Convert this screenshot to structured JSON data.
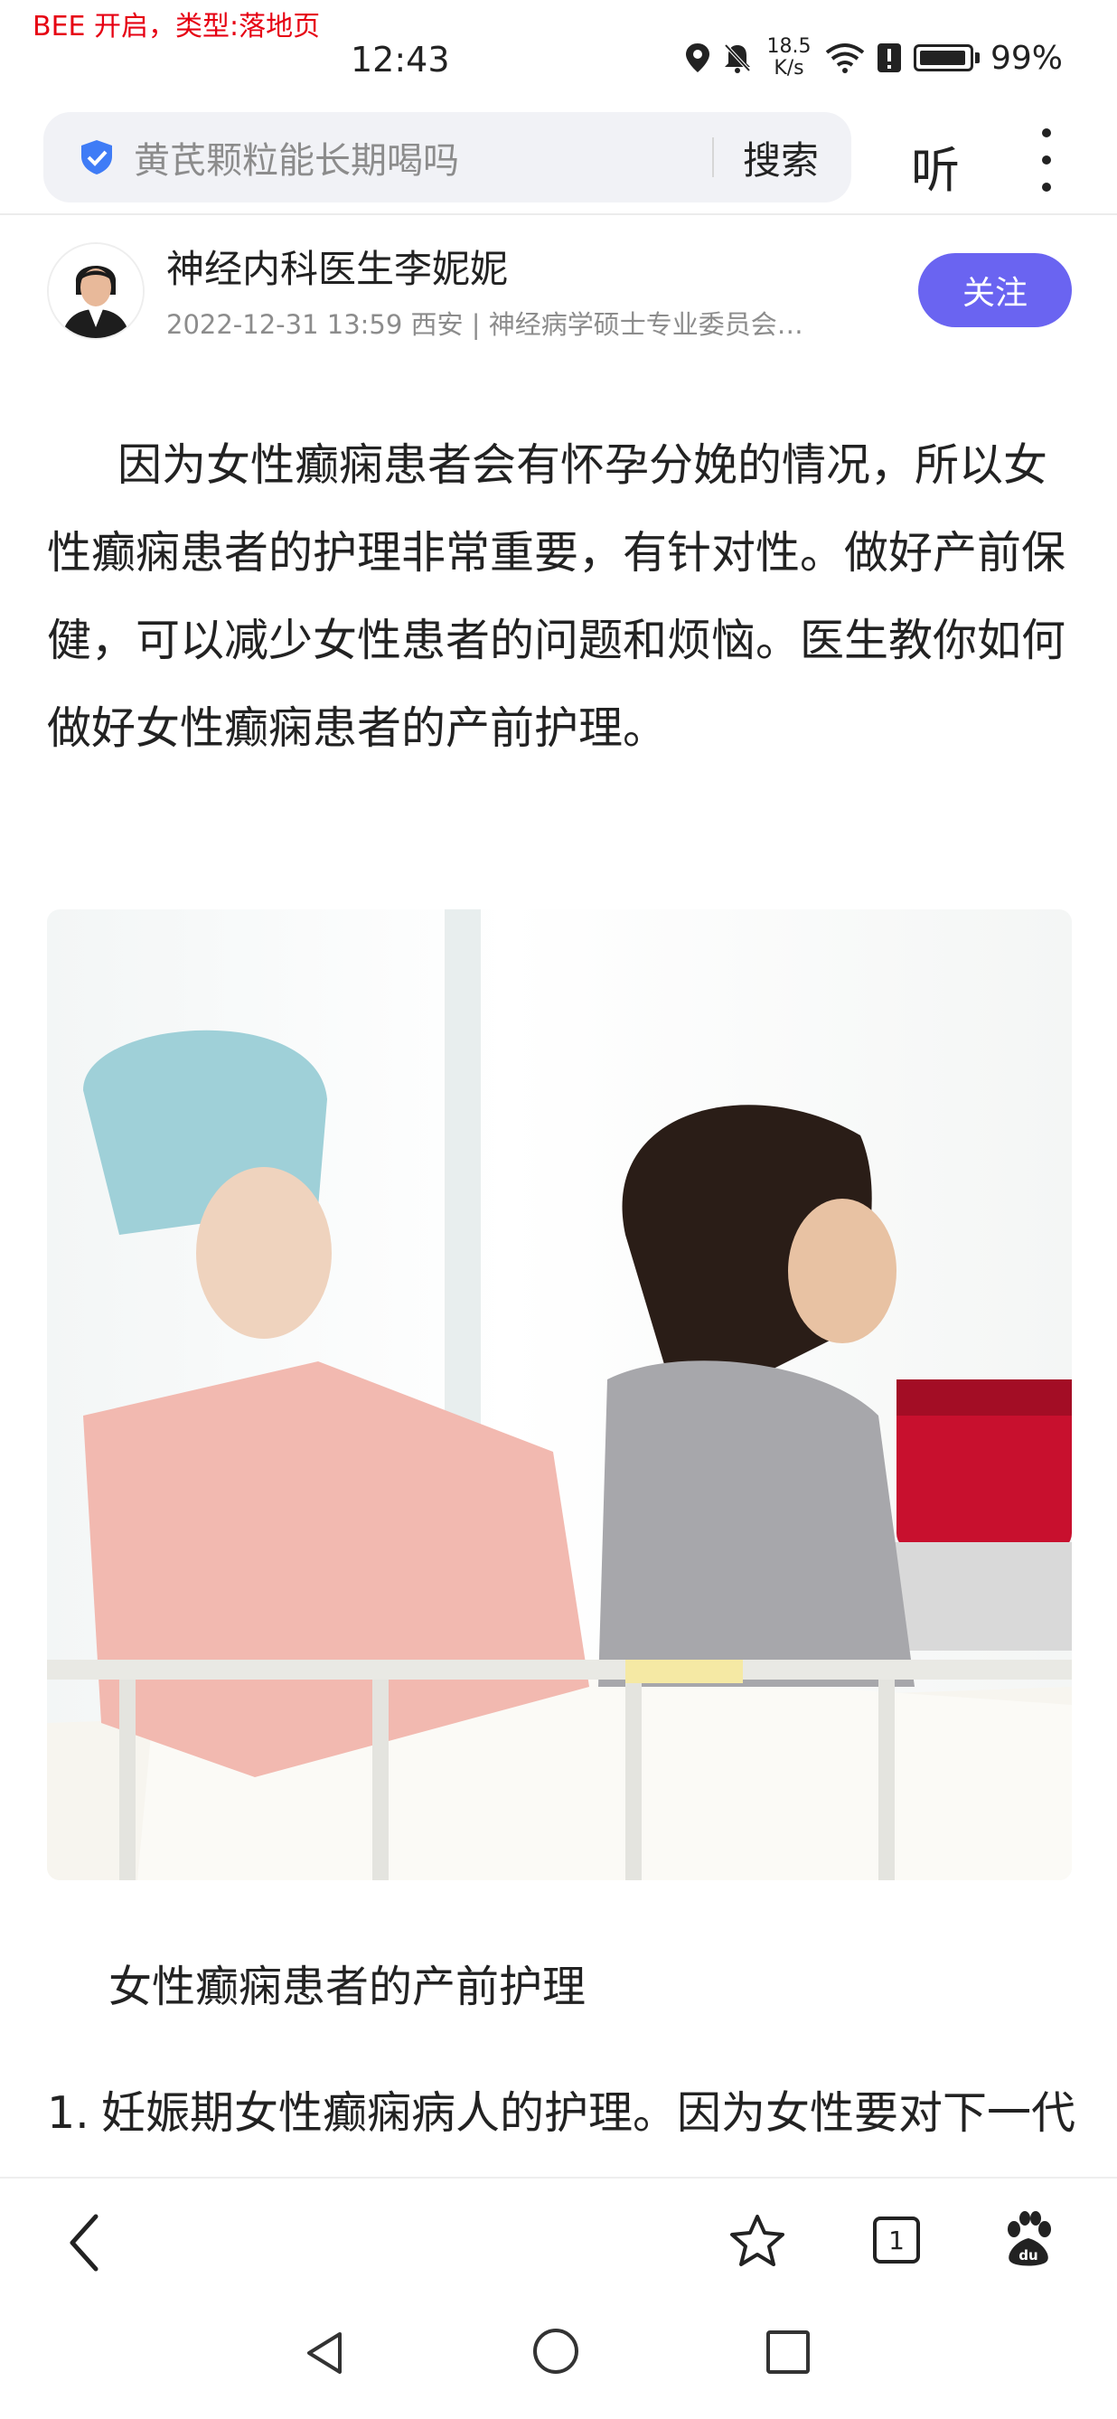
{
  "debug_banner": "BEE 开启，类型:落地页",
  "status_bar": {
    "time": "12:43",
    "net_speed_value": "18.5",
    "net_speed_unit": "K/s",
    "battery": "99%"
  },
  "search": {
    "query": "黄芪颗粒能长期喝吗",
    "button_label": "搜索",
    "listen_label": "听"
  },
  "author": {
    "name": "神经内科医生李妮妮",
    "meta": "2022-12-31 13:59 西安 | 神经病学硕士专业委员会…",
    "follow_label": "关注"
  },
  "article": {
    "intro": "因为女性癫痫患者会有怀孕分娩的情况，所以女性癫痫患者的护理非常重要，有针对性。做好产前保健，可以减少女性患者的问题和烦恼。医生教你如何做好女性癫痫患者的产前护理。",
    "subheading": "女性癫痫患者的产前护理",
    "list": [
      {
        "num": "1.",
        "text": "妊娠期女性癫痫病人的护理。因为女性要对下一代的健康负责，所以患有女性癫痫"
      }
    ]
  },
  "bottom_nav": {
    "tab_count": "1"
  },
  "colors": {
    "accent": "#6a64f1",
    "banner_red": "#e60012",
    "shield_blue": "#3f7cf6"
  }
}
